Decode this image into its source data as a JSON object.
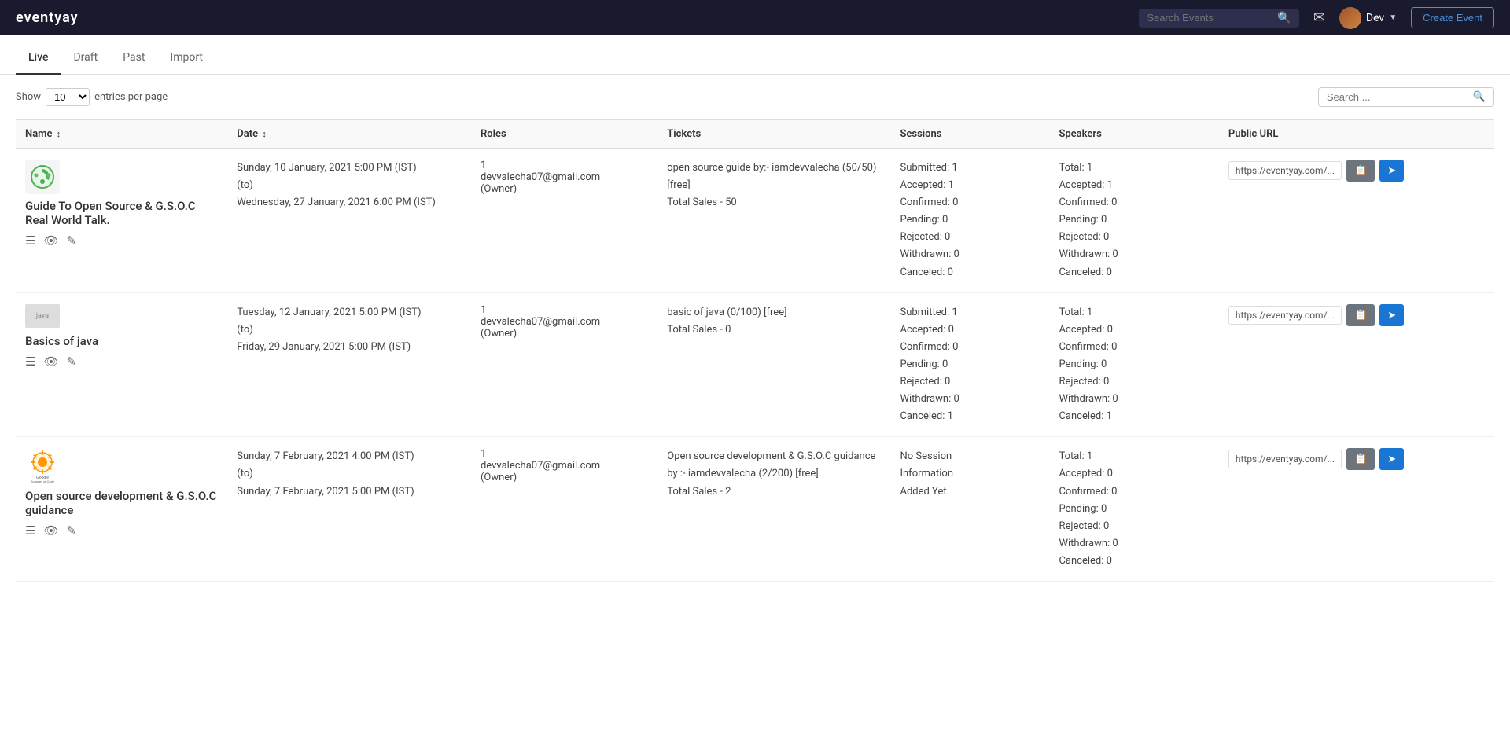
{
  "navbar": {
    "brand": "eventyay",
    "search_placeholder": "Search Events",
    "mail_icon": "mail-icon",
    "user_name": "Dev",
    "create_event_label": "Create Event"
  },
  "tabs": [
    {
      "id": "live",
      "label": "Live",
      "active": true
    },
    {
      "id": "draft",
      "label": "Draft",
      "active": false
    },
    {
      "id": "past",
      "label": "Past",
      "active": false
    },
    {
      "id": "import",
      "label": "Import",
      "active": false
    }
  ],
  "controls": {
    "show_label": "Show",
    "entries_value": "10",
    "entries_suffix": "entries per page",
    "search_placeholder": "Search ..."
  },
  "table": {
    "columns": [
      {
        "id": "name",
        "label": "Name",
        "sortable": true
      },
      {
        "id": "date",
        "label": "Date",
        "sortable": true
      },
      {
        "id": "roles",
        "label": "Roles",
        "sortable": false
      },
      {
        "id": "tickets",
        "label": "Tickets",
        "sortable": false
      },
      {
        "id": "sessions",
        "label": "Sessions",
        "sortable": false
      },
      {
        "id": "speakers",
        "label": "Speakers",
        "sortable": false
      },
      {
        "id": "url",
        "label": "Public URL",
        "sortable": false
      }
    ],
    "rows": [
      {
        "id": "event-1",
        "logo_type": "opensrc",
        "name": "Guide To Open Source & G.S.O.C Real World Talk.",
        "date_start": "Sunday, 10 January, 2021 5:00 PM (IST)",
        "date_to": "(to)",
        "date_end": "Wednesday, 27 January, 2021 6:00 PM (IST)",
        "roles_count": "1",
        "role_email": "devvalecha07@gmail.com",
        "role_type": "(Owner)",
        "ticket_desc": "open source guide by:- iamdevvalecha (50/50) [free]",
        "ticket_sales": "Total Sales - 50",
        "session_submitted": "Submitted: 1",
        "session_accepted": "Accepted: 1",
        "session_confirmed": "Confirmed: 0",
        "session_pending": "Pending: 0",
        "session_rejected": "Rejected: 0",
        "session_withdrawn": "Withdrawn: 0",
        "session_canceled": "Canceled: 0",
        "speaker_total": "Total: 1",
        "speaker_accepted": "Accepted: 1",
        "speaker_confirmed": "Confirmed: 0",
        "speaker_pending": "Pending: 0",
        "speaker_rejected": "Rejected: 0",
        "speaker_withdrawn": "Withdrawn: 0",
        "speaker_canceled": "Canceled: 0",
        "public_url": "https://eventyay.com/..."
      },
      {
        "id": "event-2",
        "logo_type": "placeholder",
        "logo_text": "java",
        "name": "Basics of java",
        "date_start": "Tuesday, 12 January, 2021 5:00 PM (IST)",
        "date_to": "(to)",
        "date_end": "Friday, 29 January, 2021 5:00 PM (IST)",
        "roles_count": "1",
        "role_email": "devvalecha07@gmail.com",
        "role_type": "(Owner)",
        "ticket_desc": "basic of java (0/100) [free]",
        "ticket_sales": "Total Sales - 0",
        "session_submitted": "Submitted: 1",
        "session_accepted": "Accepted: 0",
        "session_confirmed": "Confirmed: 0",
        "session_pending": "Pending: 0",
        "session_rejected": "Rejected: 0",
        "session_withdrawn": "Withdrawn: 0",
        "session_canceled": "Canceled: 1",
        "speaker_total": "Total: 1",
        "speaker_accepted": "Accepted: 0",
        "speaker_confirmed": "Confirmed: 0",
        "speaker_pending": "Pending: 0",
        "speaker_rejected": "Rejected: 0",
        "speaker_withdrawn": "Withdrawn: 0",
        "speaker_canceled": "Canceled: 1",
        "public_url": "https://eventyay.com/..."
      },
      {
        "id": "event-3",
        "logo_type": "gsoc",
        "name": "Open source development & G.S.O.C guidance",
        "date_start": "Sunday, 7 February, 2021 4:00 PM (IST)",
        "date_to": "(to)",
        "date_end": "Sunday, 7 February, 2021 5:00 PM (IST)",
        "roles_count": "1",
        "role_email": "devvalecha07@gmail.com",
        "role_type": "(Owner)",
        "ticket_desc": "Open source development & G.S.O.C guidance by :- iamdevvalecha (2/200) [free]",
        "ticket_sales": "Total Sales - 2",
        "session_submitted": "No Session",
        "session_accepted": "Information",
        "session_confirmed": "Added Yet",
        "session_pending": "",
        "session_rejected": "",
        "session_withdrawn": "",
        "session_canceled": "",
        "speaker_total": "Total: 1",
        "speaker_accepted": "Accepted: 0",
        "speaker_confirmed": "Confirmed: 0",
        "speaker_pending": "Pending: 0",
        "speaker_rejected": "Rejected: 0",
        "speaker_withdrawn": "Withdrawn: 0",
        "speaker_canceled": "Canceled: 0",
        "public_url": "https://eventyay.com/..."
      }
    ]
  }
}
